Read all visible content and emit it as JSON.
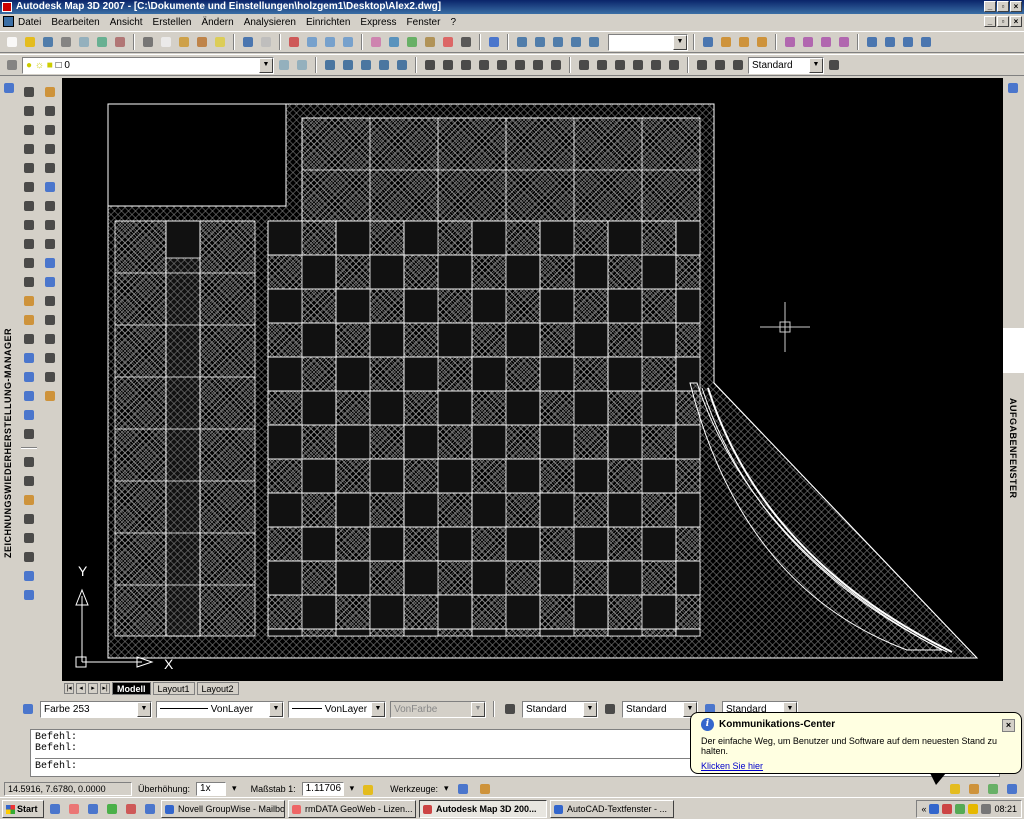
{
  "window": {
    "title": "Autodesk Map 3D 2007 - [C:\\Dokumente und Einstellungen\\holzgem1\\Desktop\\Alex2.dwg]"
  },
  "menu": [
    "Datei",
    "Bearbeiten",
    "Ansicht",
    "Erstellen",
    "Ändern",
    "Analysieren",
    "Einrichten",
    "Express",
    "Fenster",
    "?"
  ],
  "layer_toolbar": {
    "layer_value": "0",
    "text_style": "Standard"
  },
  "left_panel": {
    "vertical_label": "ZEICHNUNGSWIEDERHERSTELLUNG-MANAGER"
  },
  "right_panel": {
    "vertical_label": "AUFGABENFENSTER"
  },
  "drawing": {
    "ucs_y_label": "Y",
    "ucs_x_label": "X"
  },
  "layout_tabs": [
    "Modell",
    "Layout1",
    "Layout2"
  ],
  "properties": {
    "color": "Farbe 253",
    "linetype": "VonLayer",
    "lineweight": "VonLayer",
    "plotstyle": "VonFarbe",
    "text_style": "Standard",
    "dim_style": "Standard",
    "table_style": "Standard"
  },
  "command_lines": [
    "Befehl:",
    "Befehl:",
    "Befehl:"
  ],
  "status": {
    "coordinates": "14.5916, 7.6780, 0.0000",
    "exaggeration_label": "Überhöhung:",
    "exaggeration_value": "1x",
    "scale_label": "Maßstab 1:",
    "scale_value": "1.11706",
    "tools_label": "Werkzeuge:"
  },
  "balloon": {
    "title": "Kommunikations-Center",
    "body": "Der einfache Weg, um Benutzer und Software auf dem neuesten Stand zu halten.",
    "link": "Klicken Sie hier"
  },
  "taskbar": {
    "start_label": "Start",
    "buttons": [
      {
        "label": "Novell GroupWise - Mailbox",
        "active": false
      },
      {
        "label": "rmDATA GeoWeb - Lizen...",
        "active": false
      },
      {
        "label": "Autodesk Map 3D 200...",
        "active": true
      },
      {
        "label": "AutoCAD-Textfenster - ...",
        "active": false
      }
    ],
    "clock": "08:21"
  },
  "colors": {
    "title_bar": "#0a246a",
    "background": "#d4d0c8",
    "drawing_bg": "#000000",
    "linework": "#ffffff"
  }
}
